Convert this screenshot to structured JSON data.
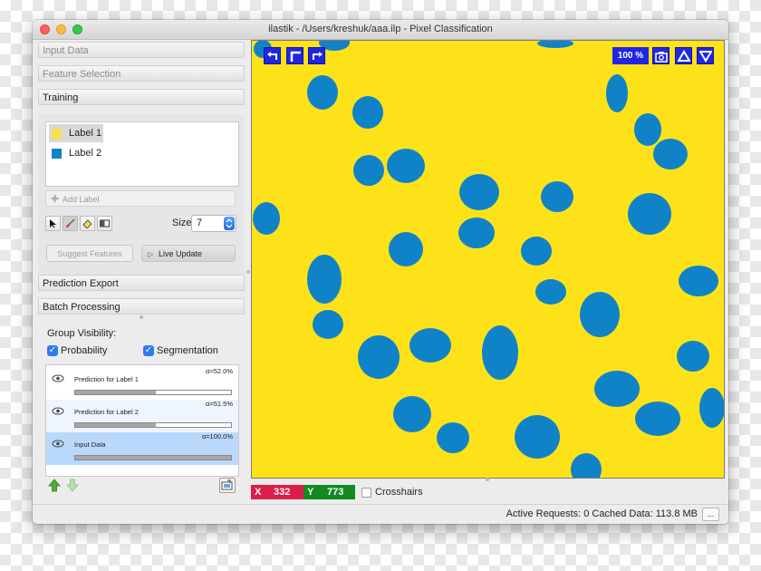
{
  "window": {
    "title": "ilastik - /Users/kreshuk/aaa.ilp - Pixel Classification"
  },
  "applets": {
    "input_data": "Input Data",
    "feature_selection": "Feature Selection",
    "training": "Training",
    "prediction_export": "Prediction Export",
    "batch_processing": "Batch Processing"
  },
  "training": {
    "labels": [
      {
        "name": "Label 1",
        "color": "#f5e24a"
      },
      {
        "name": "Label 2",
        "color": "#1083c8"
      }
    ],
    "add_label": "Add Label",
    "tools": [
      "pointer-icon",
      "brush-icon",
      "eraser-icon",
      "threshold-icon"
    ],
    "size_label": "Size:",
    "size_value": "7",
    "suggest_features": "Suggest Features",
    "live_update": "Live Update"
  },
  "group_visibility": {
    "title": "Group Visibility:",
    "probability": "Probability",
    "segmentation": "Segmentation"
  },
  "layers": [
    {
      "name": "Prediction for Label 1",
      "alpha": "α=52.0%",
      "opacity": 0.52
    },
    {
      "name": "Prediction for Label 2",
      "alpha": "α=51.5%",
      "opacity": 0.515
    },
    {
      "name": "Input Data",
      "alpha": "α=100.0%",
      "opacity": 1.0
    }
  ],
  "viewer": {
    "zoom": "100 %",
    "background_color": "#fde21a",
    "cell_color": "#1083c8"
  },
  "coords": {
    "x_label": "X",
    "x_value": "332",
    "y_label": "Y",
    "y_value": "773",
    "crosshairs": "Crosshairs"
  },
  "status": {
    "text": "Active Requests: 0  Cached Data: 113.8 MB",
    "more": "..."
  }
}
